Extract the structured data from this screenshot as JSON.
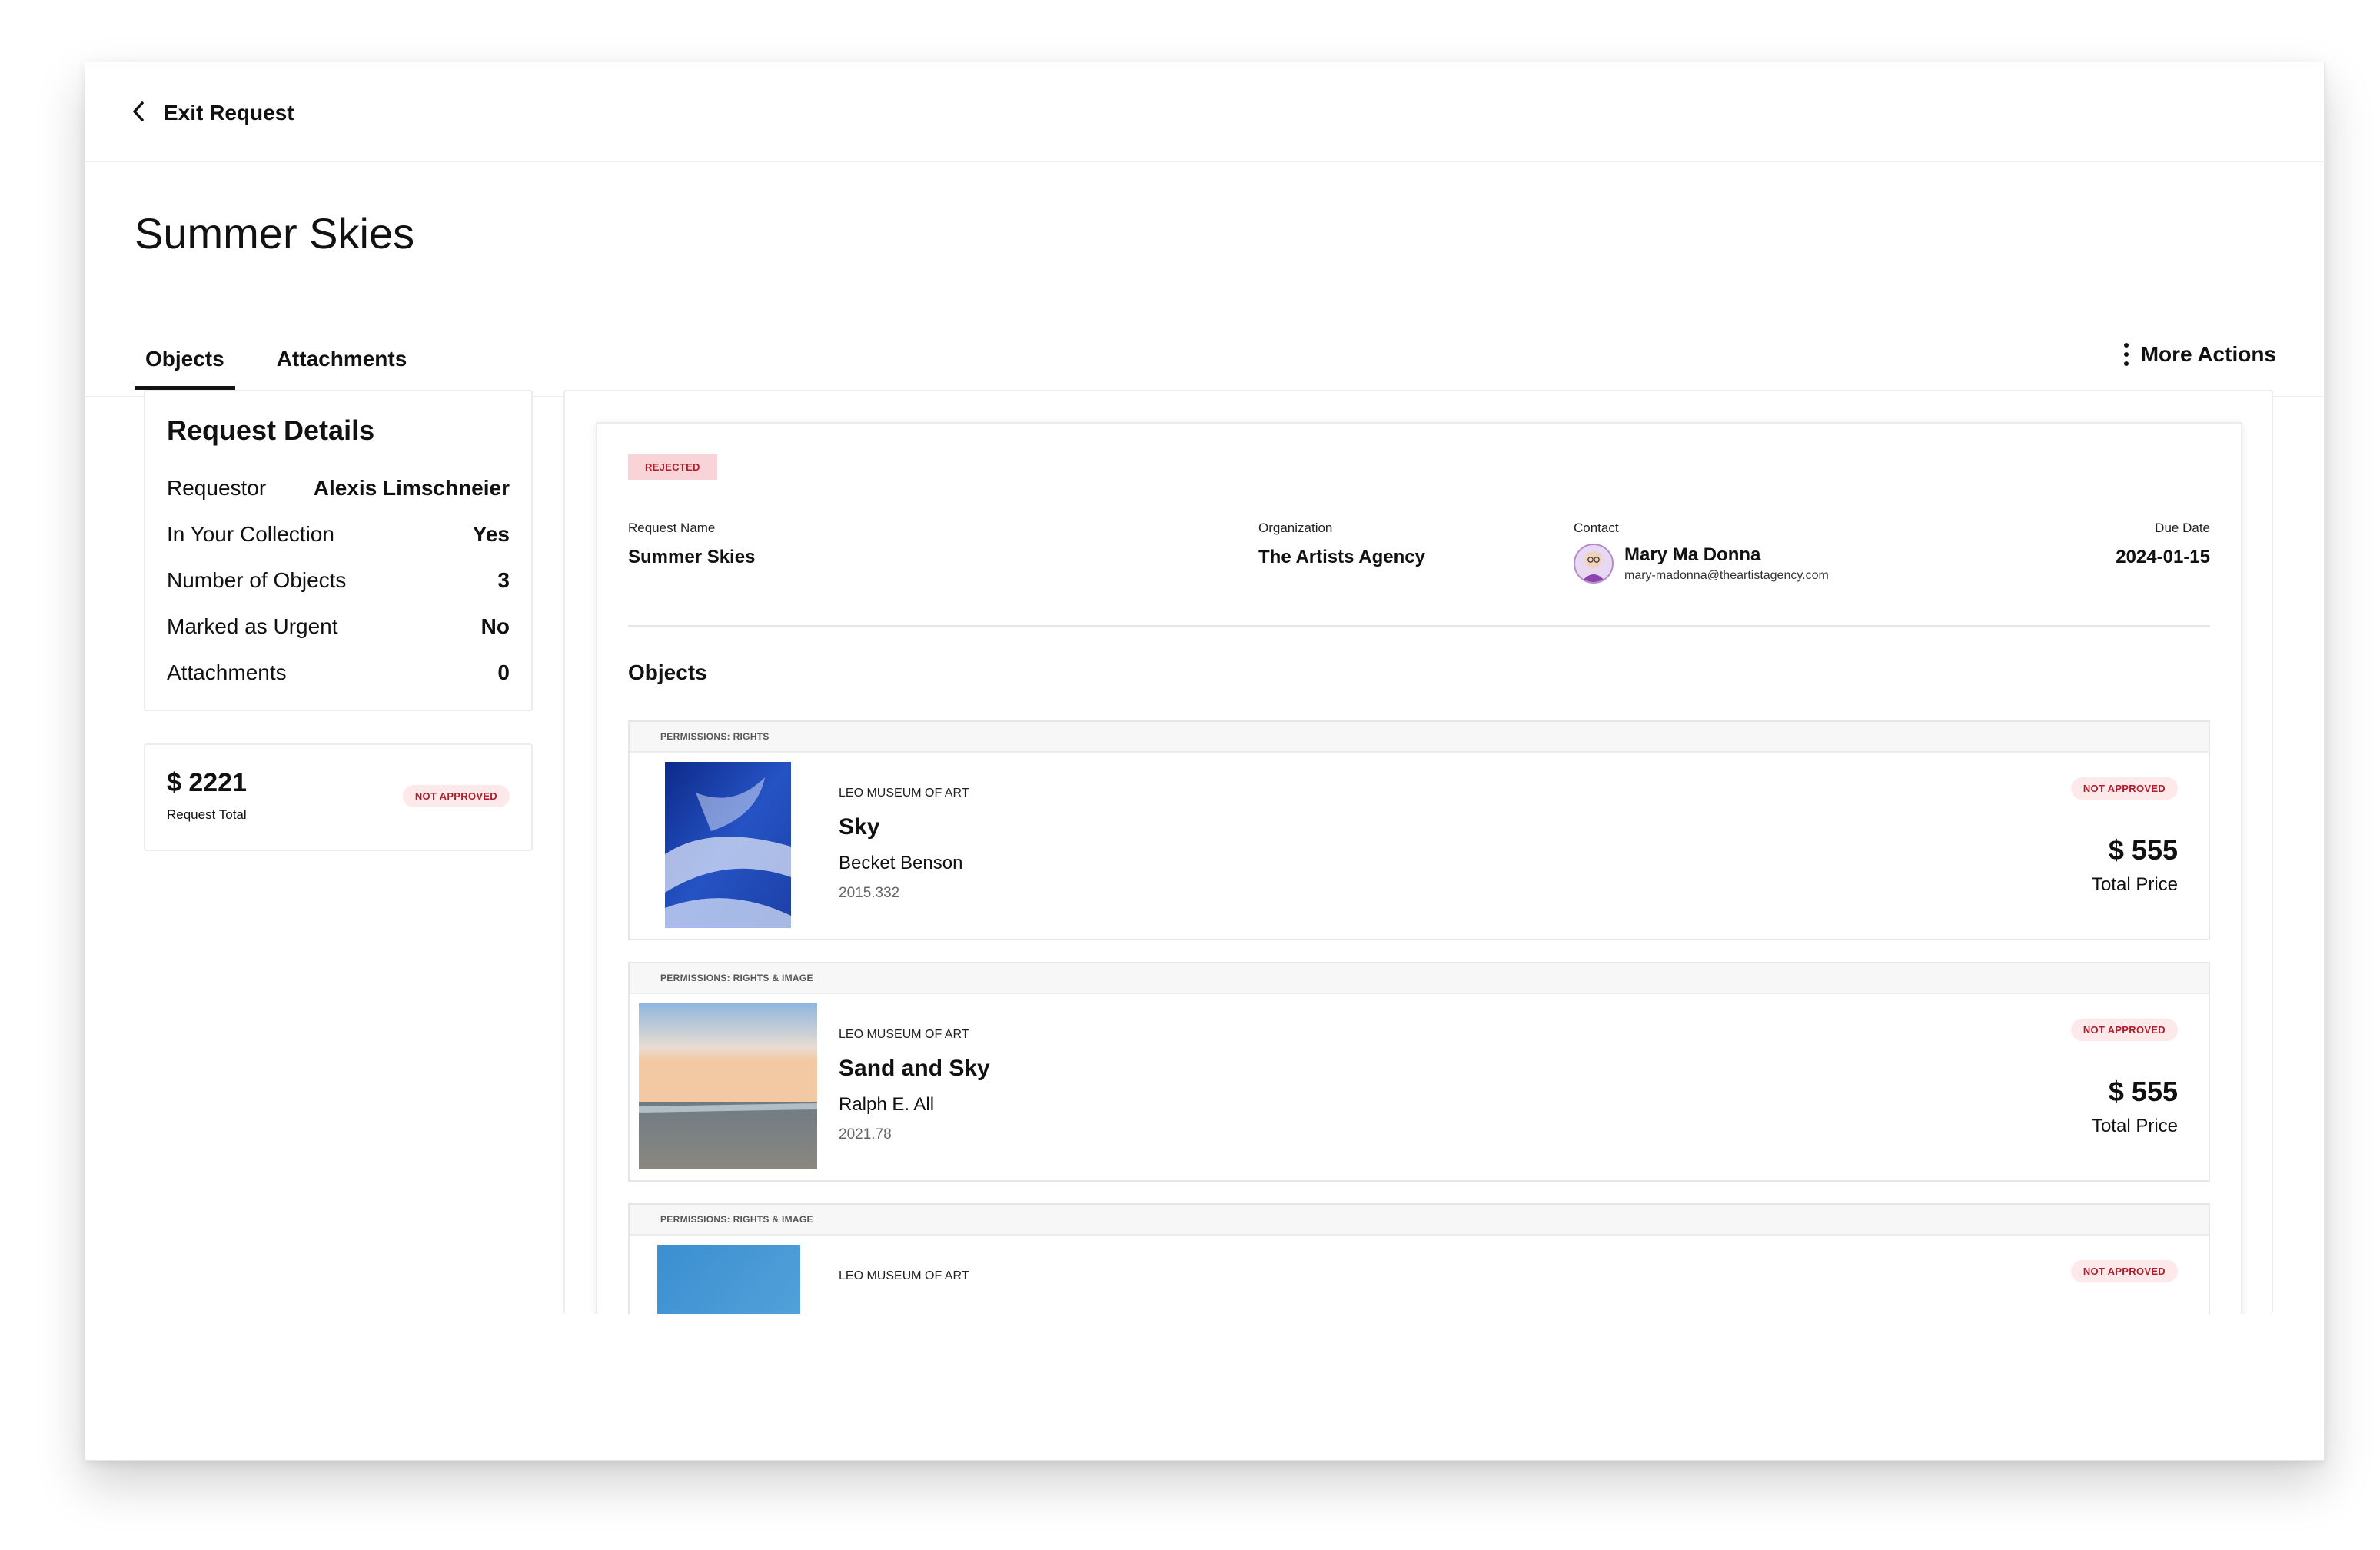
{
  "nav": {
    "exit_label": "Exit Request"
  },
  "page": {
    "title": "Summer Skies"
  },
  "tabs": [
    {
      "label": "Objects",
      "active": true
    },
    {
      "label": "Attachments",
      "active": false
    }
  ],
  "more_actions_label": "More Actions",
  "request_details": {
    "heading": "Request Details",
    "rows": [
      {
        "label": "Requestor",
        "value": "Alexis Limschneier"
      },
      {
        "label": "In Your Collection",
        "value": "Yes"
      },
      {
        "label": "Number of Objects",
        "value": "3"
      },
      {
        "label": "Marked as Urgent",
        "value": "No"
      },
      {
        "label": "Attachments",
        "value": "0"
      }
    ]
  },
  "request_total": {
    "amount": "$ 2221",
    "label": "Request Total",
    "status": "NOT APPROVED"
  },
  "summary": {
    "status": "REJECTED",
    "request_name_label": "Request Name",
    "request_name": "Summer Skies",
    "organization_label": "Organization",
    "organization": "The Artists Agency",
    "contact_label": "Contact",
    "contact_name": "Mary Ma Donna",
    "contact_email": "mary-madonna@theartistagency.com",
    "due_label": "Due Date",
    "due_date": "2024-01-15"
  },
  "objects_heading": "Objects",
  "objects": [
    {
      "permissions": "PERMISSIONS: RIGHTS",
      "museum": "LEO MUSEUM OF ART",
      "title": "Sky",
      "artist": "Becket Benson",
      "accession": "2015.332",
      "status": "NOT APPROVED",
      "price": "$ 555",
      "price_label": "Total Price"
    },
    {
      "permissions": "PERMISSIONS: RIGHTS & IMAGE",
      "museum": "LEO MUSEUM OF ART",
      "title": "Sand and Sky",
      "artist": "Ralph E. All",
      "accession": "2021.78",
      "status": "NOT APPROVED",
      "price": "$ 555",
      "price_label": "Total Price"
    },
    {
      "permissions": "PERMISSIONS: RIGHTS & IMAGE",
      "museum": "LEO MUSEUM OF ART",
      "status": "NOT APPROVED"
    }
  ],
  "colors": {
    "accent_red": "#b01d2b",
    "badge_bg": "#fde8ea",
    "rejected_bg": "#f8d4d8"
  },
  "icons": {
    "back": "chevron-left-icon",
    "more": "kebab-icon"
  }
}
